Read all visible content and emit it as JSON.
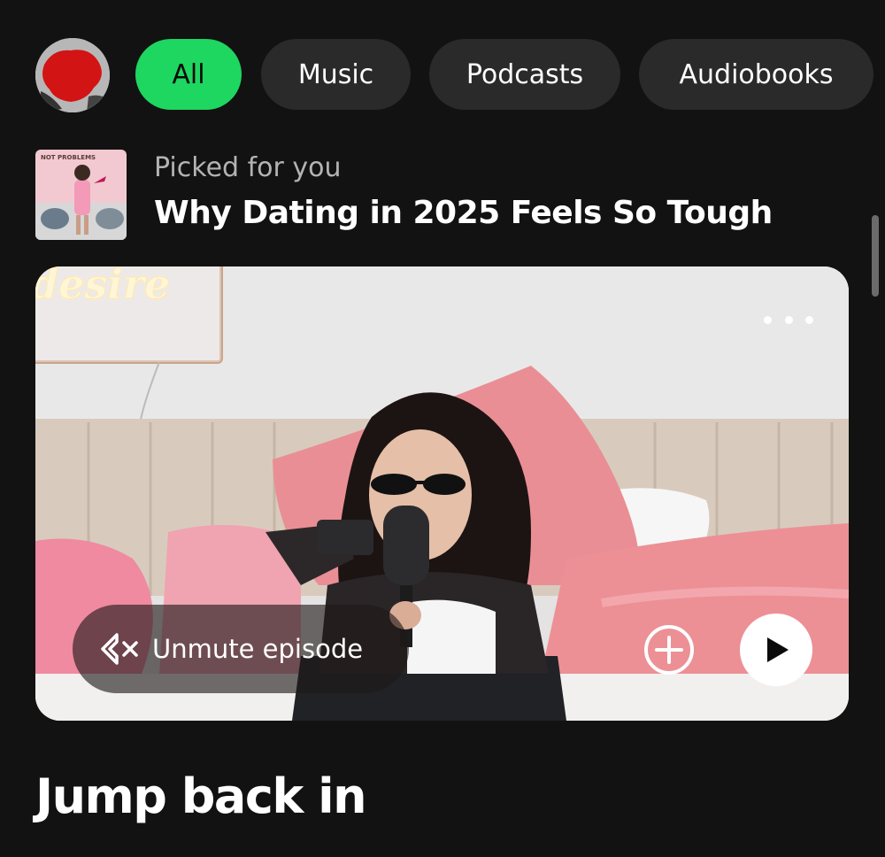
{
  "filters": {
    "chips": [
      {
        "label": "All",
        "active": true
      },
      {
        "label": "Music",
        "active": false
      },
      {
        "label": "Podcasts",
        "active": false
      },
      {
        "label": "Audiobooks",
        "active": false
      }
    ]
  },
  "picked": {
    "label": "Picked for you",
    "title": "Why Dating in 2025 Feels So Tough",
    "thumbnail_text": "NOT PROBLEMS"
  },
  "video": {
    "neon_sign_text": "desire",
    "unmute_label": "Unmute episode",
    "more_icon": "more-horizontal-icon",
    "add_icon": "plus-circle-icon",
    "play_icon": "play-icon",
    "mute_icon": "speaker-muted-icon"
  },
  "section": {
    "heading": "Jump back in"
  },
  "colors": {
    "background": "#121212",
    "accent": "#1ed760",
    "chip": "#2a2a2a",
    "secondary_text": "#b3b3b3"
  }
}
